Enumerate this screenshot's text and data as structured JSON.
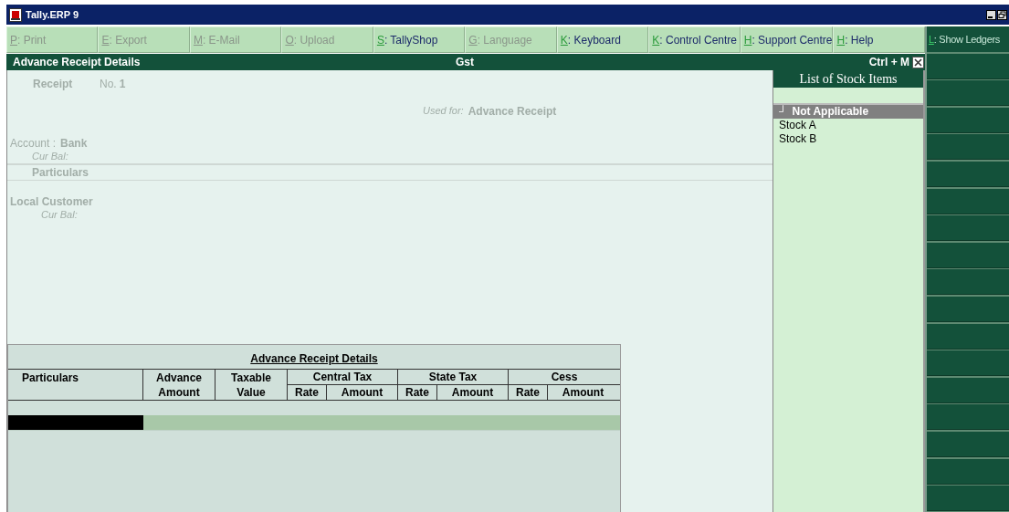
{
  "window": {
    "title": "Tally.ERP 9"
  },
  "toolbar": [
    {
      "key": "P",
      "label": ": Print",
      "disabled": true
    },
    {
      "key": "E",
      "label": ": Export",
      "disabled": true
    },
    {
      "key": "M",
      "label": ": E-Mail",
      "disabled": true
    },
    {
      "key": "O",
      "label": ": Upload",
      "disabled": true
    },
    {
      "key": "S",
      "label": ": TallyShop",
      "disabled": false
    },
    {
      "key": "G",
      "label": ": Language",
      "disabled": true
    },
    {
      "key": "K",
      "label": ": Keyboard",
      "disabled": false
    },
    {
      "key": "K",
      "label": ": Control Centre",
      "disabled": false
    },
    {
      "key": "H",
      "label": ": Support Centre",
      "disabled": false
    },
    {
      "key": "H",
      "label": ": Help",
      "disabled": false
    }
  ],
  "side_buttons": [
    {
      "key": "L",
      "label": ": Show Ledgers"
    }
  ],
  "header": {
    "title": "Advance Receipt Details",
    "company": "Gst",
    "shortcut": "Ctrl + M"
  },
  "voucher": {
    "type_label": "Receipt",
    "number_label": "No.",
    "number": "1",
    "used_for_label": "Used for:",
    "used_for": "Advance Receipt",
    "account_label": "Account :",
    "account": "Bank",
    "account_balance_label": "Cur Bal:",
    "particulars_heading": "Particulars",
    "entries": [
      {
        "ledger": "Local Customer",
        "balance_label": "Cur Bal:"
      }
    ]
  },
  "details_table": {
    "title": "Advance Receipt Details",
    "columns": [
      {
        "label": "Particulars"
      },
      {
        "label": "Advance Amount"
      },
      {
        "label": "Taxable Value"
      },
      {
        "label": "Central Tax",
        "subcolumns": [
          "Rate",
          "Amount"
        ]
      },
      {
        "label": "State Tax",
        "subcolumns": [
          "Rate",
          "Amount"
        ]
      },
      {
        "label": "Cess",
        "subcolumns": [
          "Rate",
          "Amount"
        ]
      }
    ],
    "rows": [
      {
        "selected": true
      }
    ]
  },
  "stock_list": {
    "title": "List of Stock Items",
    "items": [
      {
        "marker": "┘",
        "label": "Not Applicable",
        "selected": true
      },
      {
        "label": "Stock A",
        "selected": false
      },
      {
        "label": "Stock B",
        "selected": false
      }
    ]
  }
}
